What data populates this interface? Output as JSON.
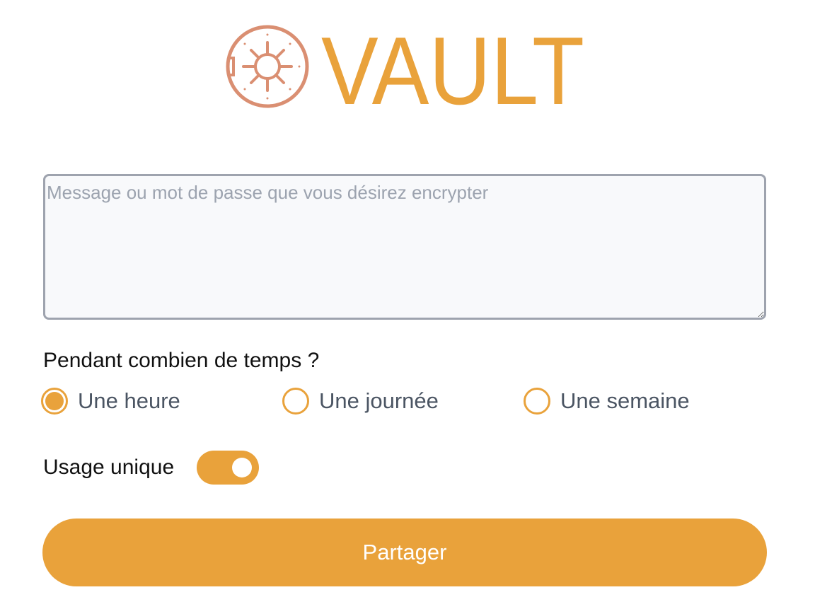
{
  "logo": {
    "text": "VAULT",
    "icon": "vault-dial-icon",
    "ring_color": "#da8f72",
    "text_color": "#e9a23b"
  },
  "message": {
    "placeholder": "Message ou mot de passe que vous désirez encrypter",
    "value": ""
  },
  "duration": {
    "label": "Pendant combien de temps ?",
    "options": [
      {
        "label": "Une heure",
        "selected": true
      },
      {
        "label": "Une journée",
        "selected": false
      },
      {
        "label": "Une semaine",
        "selected": false
      }
    ]
  },
  "single_use": {
    "label": "Usage unique",
    "enabled": true
  },
  "share_button": {
    "label": "Partager"
  },
  "colors": {
    "accent": "#e9a23b",
    "input_border": "#9ea3ae",
    "input_bg": "#f8f9fb"
  }
}
